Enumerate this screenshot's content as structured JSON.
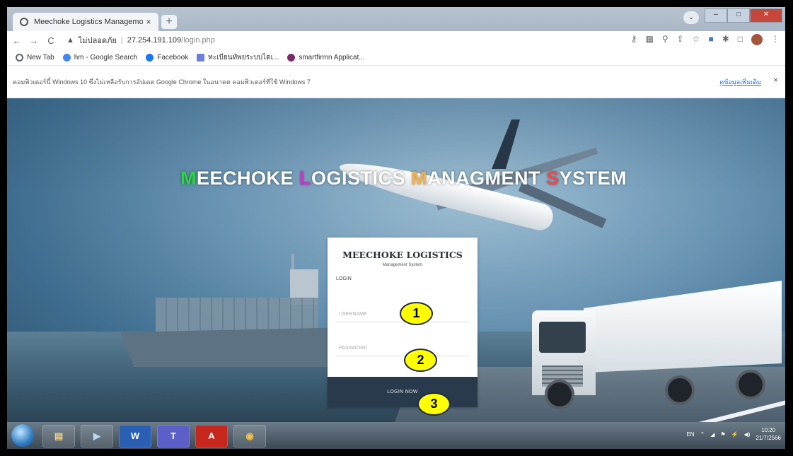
{
  "browser": {
    "tab_title": "Meechoke Logistics Managemo",
    "tab_close": "×",
    "new_tab": "+",
    "address": {
      "security": "ไม่ปลอดภัย",
      "host": "27.254.191.109",
      "path": "/login.php"
    },
    "nav": {
      "back": "←",
      "forward": "→",
      "reload": "C"
    },
    "window_controls": {
      "minimize": "–",
      "maximize": "□",
      "close": "✕"
    }
  },
  "bookmarks": [
    {
      "label": "New Tab",
      "color": "#5f6368"
    },
    {
      "label": "hm - Google Search",
      "color": "#4285f4"
    },
    {
      "label": "Facebook",
      "color": "#1877f2"
    },
    {
      "label": "ทะเบียนทัพยระบบไดเ...",
      "color": "#6d7fd8"
    },
    {
      "label": "smartfirmn Applicat...",
      "color": "#7a2a6b"
    }
  ],
  "infobar": {
    "message": "คอมพิวเตอร์นี้ Windows 10 ซึ่งไม่เหลือรับการอัปเดต Google Chrome ในอนาคต คอมพิวเตอร์ที่ใช้ Windows 7",
    "link": "ดูข้อมูลเพิ่มเติม",
    "close": "×"
  },
  "page": {
    "headline": {
      "w1_first": "M",
      "w1_rest": "EECHOKE ",
      "w2_first": "L",
      "w2_rest": "OGISTICS ",
      "w3_first": "M",
      "w3_rest": "ANAGMENT ",
      "w4_first": "S",
      "w4_rest": "YSTEM"
    },
    "login": {
      "brand": "MEECHOKE LOGISTICS",
      "subtitle": "Management System",
      "section": "LOGIN",
      "username_placeholder": "USERNAME",
      "password_placeholder": "PASSWORD",
      "submit": "LOGIN NOW"
    },
    "callouts": [
      "1",
      "2",
      "3"
    ]
  },
  "taskbar": {
    "apps": [
      {
        "name": "explorer",
        "glyph": "▤"
      },
      {
        "name": "media",
        "glyph": "▶"
      },
      {
        "name": "word",
        "glyph": "W"
      },
      {
        "name": "teams",
        "glyph": "T"
      },
      {
        "name": "acrobat",
        "glyph": "A"
      },
      {
        "name": "chrome",
        "glyph": "◉"
      }
    ],
    "lang": "EN",
    "time": "10:20",
    "date": "21/7/2566"
  }
}
